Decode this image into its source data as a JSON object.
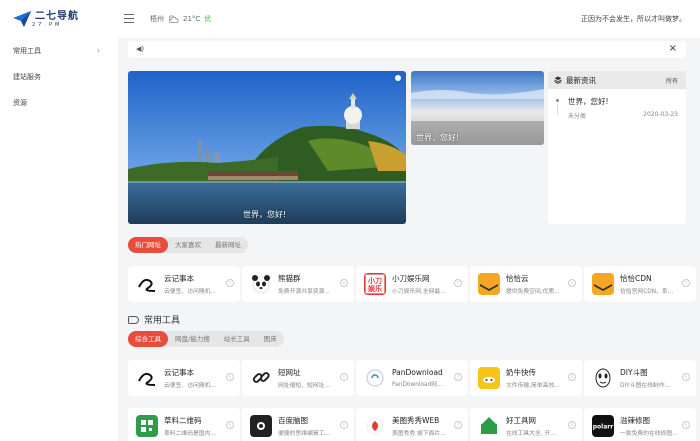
{
  "header": {
    "logo_text": "二七导航",
    "logo_sub": "27.PM",
    "city": "梧州",
    "temp": "21°C",
    "air": "优",
    "slogan": "正因为不会发生，所以才叫做梦。"
  },
  "sidebar": {
    "items": [
      {
        "label": "常用工具",
        "has_arrow": true
      },
      {
        "label": "建站服务",
        "has_arrow": false
      },
      {
        "label": "资源",
        "has_arrow": false
      }
    ]
  },
  "notice": {
    "close": "×"
  },
  "hero": {
    "main_caption": "世界，您好!",
    "side_caption": "世界，您好!"
  },
  "news": {
    "title": "最新资讯",
    "more": "所有",
    "items": [
      {
        "title": "世界，您好!",
        "category": "未分类",
        "date": "2020-03-23"
      }
    ]
  },
  "hot_tabs": [
    "热门网址",
    "大家喜欢",
    "最新网址"
  ],
  "hot_cards": [
    {
      "name": "云记事本",
      "desc": "云便签、访问随机...",
      "icon": "yunji-icon",
      "color": "#ffffff"
    },
    {
      "name": "熊猫群",
      "desc": "免费开源共享资源...",
      "icon": "panda-icon",
      "color": "#ffffff"
    },
    {
      "name": "小刀娱乐网",
      "desc": "小刀娱乐网,全网最...",
      "icon": "xiaodao-icon",
      "color": "#e53935"
    },
    {
      "name": "恰恰云",
      "desc": "提供免费空间,优质...",
      "icon": "layers-icon",
      "color": "#f5a623"
    },
    {
      "name": "恰恰CDN",
      "desc": "恰恰官网CDN、系...",
      "icon": "layers-icon",
      "color": "#f5a623"
    }
  ],
  "section": {
    "title": "常用工具"
  },
  "tool_tabs": [
    "综合工具",
    "网盘/能力搜",
    "站长工具",
    "图床"
  ],
  "tool_cards": [
    {
      "name": "云记事本",
      "desc": "云便签、访问随机...",
      "icon": "yunji-icon",
      "color": "#ffffff"
    },
    {
      "name": "短网址",
      "desc": "网址缩短、短网址...",
      "icon": "link-icon",
      "color": "#ffffff"
    },
    {
      "name": "PanDownload",
      "desc": "PanDownload网...",
      "icon": "pandownload-icon",
      "color": "#ffffff"
    },
    {
      "name": "奶牛快传",
      "desc": "文件传输,简单高效...",
      "icon": "cow-icon",
      "color": "#f5c518"
    },
    {
      "name": "DIY斗图",
      "desc": "DIY斗图在线制作...",
      "icon": "diy-icon",
      "color": "#ffffff"
    }
  ],
  "tool_cards_row2": [
    {
      "name": "草料二维码",
      "desc": "草料二维码是国内...",
      "icon": "qrcode-icon",
      "color": "#2e9c4a"
    },
    {
      "name": "百度脑图",
      "desc": "便捷的思维编辑工...",
      "icon": "naotu-icon",
      "color": "#222222"
    },
    {
      "name": "美图秀秀WEB",
      "desc": "美图秀秀 拔下面片...",
      "icon": "meitu-icon",
      "color": "#ffffff"
    },
    {
      "name": "好工具网",
      "desc": "在线工具大全, 开...",
      "icon": "haogongju-icon",
      "color": "#ffffff"
    },
    {
      "name": "溢辣修图",
      "desc": "一款免费的在线修图...",
      "icon": "polarr-icon",
      "color": "#111111"
    }
  ]
}
